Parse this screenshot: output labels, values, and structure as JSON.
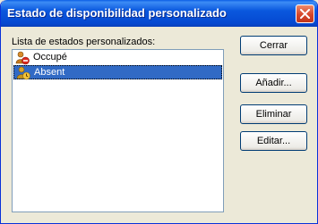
{
  "window": {
    "title": "Estado de disponibilidad personalizado"
  },
  "list": {
    "label": "Lista de estados personalizados:",
    "items": [
      {
        "label": "Occupé",
        "icon": "busy-status-icon",
        "selected": false
      },
      {
        "label": "Absent",
        "icon": "away-status-icon",
        "selected": true
      }
    ]
  },
  "buttons": {
    "close": "Cerrar",
    "add": "Añadir...",
    "delete": "Eliminar",
    "edit": "Editar..."
  },
  "colors": {
    "titlebar": "#0a58de",
    "selection": "#316ac5",
    "dialog_bg": "#ece9d8"
  }
}
